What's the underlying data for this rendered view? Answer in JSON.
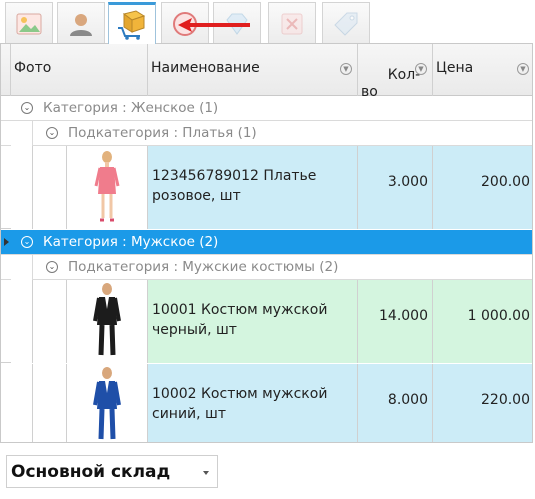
{
  "toolbar": {
    "buttons": [
      {
        "name": "picture-icon",
        "state": "normal"
      },
      {
        "name": "user-icon",
        "state": "normal"
      },
      {
        "name": "box-cart-icon",
        "state": "active"
      },
      {
        "name": "no-entry-icon",
        "state": "normal"
      },
      {
        "name": "diamond-icon",
        "state": "disabled"
      },
      {
        "name": "delete-icon",
        "state": "disabled"
      },
      {
        "name": "price-tag-icon",
        "state": "disabled"
      }
    ],
    "arrow_color": "#e01f1f"
  },
  "grid": {
    "columns": {
      "photo": "Фото",
      "name": "Наименование",
      "qty": "Кол-\nво",
      "price": "Цена"
    },
    "groups": [
      {
        "category": "Категория : Женское (1)",
        "selected": false,
        "subcategory": "Подкатегория : Платья (1)",
        "items": [
          {
            "name": "123456789012 Платье розовое, шт",
            "qty": "3.000",
            "price": "200.00",
            "highlight": "blue",
            "photo": "pink-dress"
          }
        ]
      },
      {
        "category": "Категория : Мужское (2)",
        "selected": true,
        "subcategory": "Подкатегория : Мужские костюмы (2)",
        "items": [
          {
            "name": "10001 Костюм мужской черный, шт",
            "qty": "14.000",
            "price": "1 000.00",
            "highlight": "green",
            "photo": "black-suit"
          },
          {
            "name": "10002 Костюм мужской синий, шт",
            "qty": "8.000",
            "price": "220.00",
            "highlight": "blue",
            "photo": "blue-suit"
          }
        ]
      }
    ],
    "colors": {
      "selection": "#1b9ae8",
      "row_blue": "#ccecf7",
      "row_green": "#d4f5df"
    }
  },
  "warehouse": {
    "selected": "Основной склад"
  }
}
